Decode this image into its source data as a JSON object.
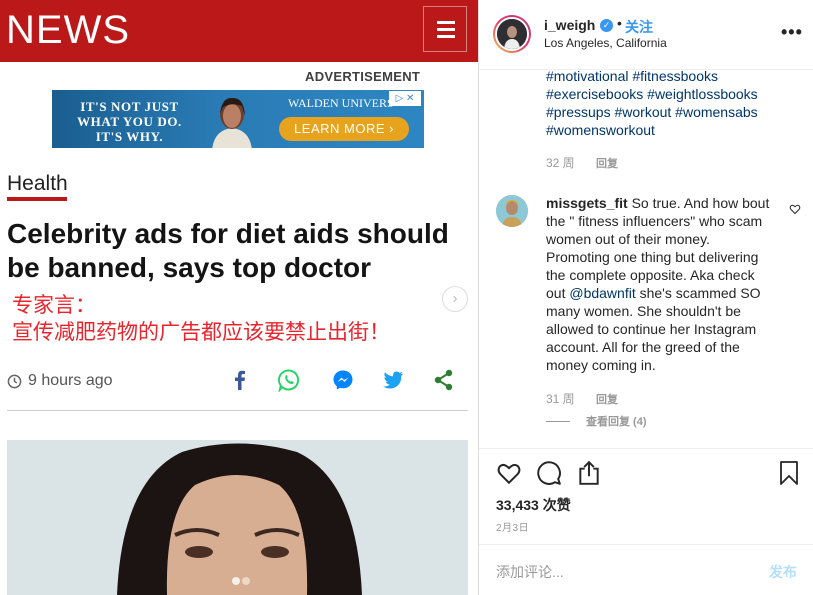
{
  "article": {
    "logo": "NEWS",
    "ad_label": "ADVERTISEMENT",
    "ad": {
      "text": "IT'S NOT JUST WHAT YOU DO. IT'S WHY.",
      "brand": "WALDEN UNIVERS",
      "cta": "LEARN MORE ›"
    },
    "section": "Health",
    "headline": "Celebrity ads for diet aids should be banned, says top doctor",
    "cn_overlay": {
      "line1": "专家言：",
      "line2": "宣传减肥药物的广告都应该要禁止出街！"
    },
    "time": "9 hours ago",
    "share": [
      "facebook-icon",
      "whatsapp-icon",
      "messenger-icon",
      "twitter-icon",
      "share-icon"
    ],
    "colors": {
      "brand_red": "#bb1919",
      "ad_orange": "#e8a31e"
    }
  },
  "instagram": {
    "username": "i_weigh",
    "verified": true,
    "follow": "关注",
    "location": "Los Angeles, California",
    "caption_hashtags": "#motivational #fitnessbooks #exercisebooks #weightlossbooks #pressups #workout #womensabs #womensworkout",
    "caption_meta": {
      "age": "32 周",
      "reply": "回复"
    },
    "comment": {
      "user": "missgets_fit",
      "text_before": " So true. And how bout the \" fitness influencers\" who scam women out of their money. Promoting one thing but delivering the complete opposite. Aka check out ",
      "mention": "@bdawnfit",
      "text_after": " she's scammed SO many women. She shouldn't be allowed to continue her Instagram account. All for the greed of the money coming in.",
      "age": "31 周",
      "reply": "回复",
      "view_replies": "查看回复 (4)"
    },
    "likes": "33,433 次赞",
    "date": "2月3日",
    "add_comment_placeholder": "添加评论...",
    "post": "发布",
    "colors": {
      "link": "#003569",
      "accent": "#3897f0"
    }
  }
}
